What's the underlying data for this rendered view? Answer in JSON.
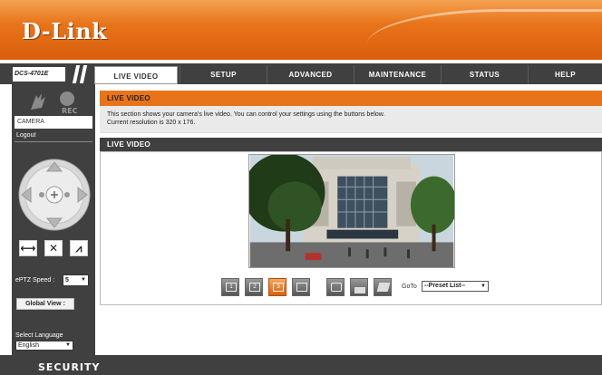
{
  "brand": {
    "logo_text": "D-Link",
    "model": "DCS-4701E",
    "accent": "#e8741a",
    "dark": "#404040"
  },
  "nav": {
    "tabs": [
      {
        "label": "LIVE VIDEO",
        "active": true
      },
      {
        "label": "SETUP"
      },
      {
        "label": "ADVANCED"
      },
      {
        "label": "MAINTENANCE"
      },
      {
        "label": "STATUS"
      },
      {
        "label": "HELP"
      }
    ]
  },
  "sidebar": {
    "rec_label": "REC",
    "camera_item": "CAMERA",
    "logout": "Logout",
    "buttons": [
      {
        "icon": "horizontal-arrows-icon",
        "glyph": "⟷"
      },
      {
        "icon": "close-icon",
        "glyph": "✕"
      },
      {
        "icon": "path-icon",
        "glyph": "⩘"
      }
    ],
    "eptz_speed_label": "ePTZ Speed :",
    "eptz_speed_value": "5",
    "global_view": "Global View :",
    "language_label": "Select Language",
    "language_value": "English"
  },
  "main": {
    "section_title": "LIVE VIDEO",
    "description_line1": "This section shows your camera's live video. You can control your settings using the buttons below.",
    "description_line2": "Current resolution is 320 x 176.",
    "live_bar_title": "LIVE VIDEO",
    "controls": [
      {
        "icon": "profile-1-icon",
        "text": "1"
      },
      {
        "icon": "profile-2-icon",
        "text": "2"
      },
      {
        "icon": "profile-3-icon",
        "text": "3",
        "active": true
      },
      {
        "icon": "fullscreen-icon",
        "text": ""
      },
      {
        "icon": "snapshot-icon",
        "text": ""
      },
      {
        "icon": "record-icon",
        "text": ""
      },
      {
        "icon": "folder-icon",
        "text": ""
      }
    ],
    "goto_label": "GoTo",
    "preset_value": "--Preset List--"
  },
  "footer": {
    "label": "SECURITY"
  }
}
